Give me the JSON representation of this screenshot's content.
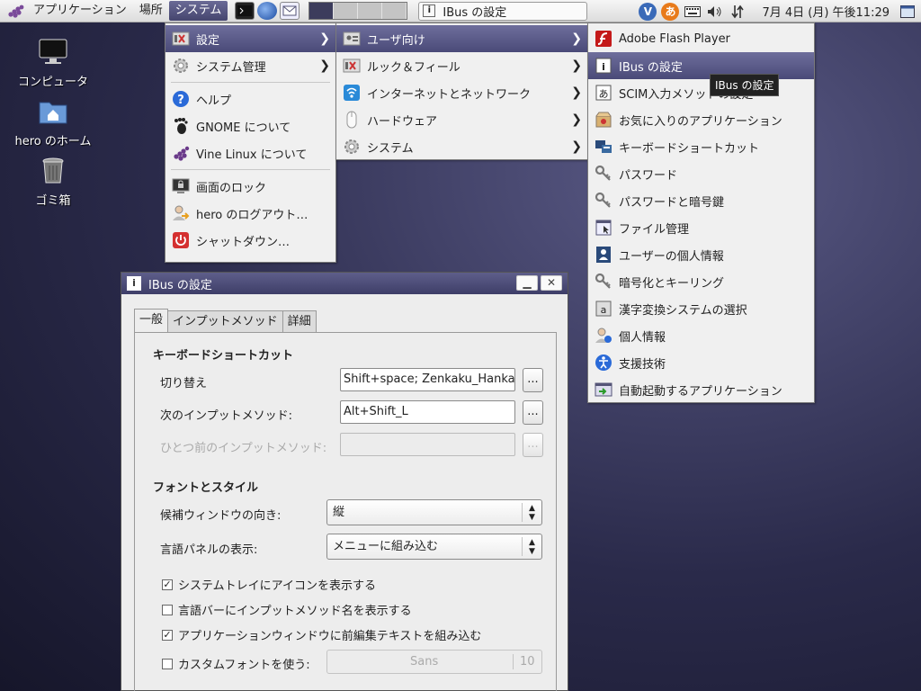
{
  "panel": {
    "menus": [
      "アプリケーション",
      "場所",
      "システム"
    ],
    "taskbar_title": "IBus の設定",
    "clock": "7月 4日 (月) 午後11:29",
    "ime_glyph": "あ",
    "vine_glyph": "V"
  },
  "desktop": [
    {
      "label": "コンピュータ",
      "icon": "computer-icon"
    },
    {
      "label": "hero のホーム",
      "icon": "home-folder-icon"
    },
    {
      "label": "ゴミ箱",
      "icon": "trash-icon"
    }
  ],
  "system_menu": {
    "items": [
      {
        "label": "設定",
        "icon": "settings-icon",
        "submenu": true,
        "highlight": true
      },
      {
        "label": "システム管理",
        "icon": "admin-gear-icon",
        "submenu": true
      },
      {
        "sep": true
      },
      {
        "label": "ヘルプ",
        "icon": "help-icon"
      },
      {
        "label": "GNOME について",
        "icon": "gnome-foot-icon"
      },
      {
        "label": "Vine Linux について",
        "icon": "vine-grape-icon"
      },
      {
        "sep": true
      },
      {
        "label": "画面のロック",
        "icon": "lock-screen-icon"
      },
      {
        "label": "hero のログアウト…",
        "icon": "logout-icon"
      },
      {
        "label": "シャットダウン…",
        "icon": "power-icon"
      }
    ]
  },
  "settings_menu": {
    "items": [
      {
        "label": "ユーザ向け",
        "icon": "user-prefs-icon",
        "submenu": true,
        "highlight": true
      },
      {
        "label": "ルック＆フィール",
        "icon": "appearance-icon",
        "submenu": true
      },
      {
        "label": "インターネットとネットワーク",
        "icon": "network-icon",
        "submenu": true
      },
      {
        "label": "ハードウェア",
        "icon": "mouse-icon",
        "submenu": true
      },
      {
        "label": "システム",
        "icon": "system-gear-icon",
        "submenu": true
      }
    ]
  },
  "user_menu": {
    "items": [
      {
        "label": "Adobe Flash Player",
        "icon": "flash-icon"
      },
      {
        "label": "IBus の設定",
        "icon": "ibus-icon",
        "highlight": true
      },
      {
        "label": "SCIM入力メソッドの設定",
        "icon": "scim-icon"
      },
      {
        "label": "お気に入りのアプリケーション",
        "icon": "favorite-apps-icon"
      },
      {
        "label": "キーボードショートカット",
        "icon": "keyboard-shortcut-icon"
      },
      {
        "label": "パスワード",
        "icon": "key-icon"
      },
      {
        "label": "パスワードと暗号鍵",
        "icon": "keys-icon"
      },
      {
        "label": "ファイル管理",
        "icon": "file-manager-icon"
      },
      {
        "label": "ユーザーの個人情報",
        "icon": "user-info-icon"
      },
      {
        "label": "暗号化とキーリング",
        "icon": "keyring-icon"
      },
      {
        "label": "漢字変換システムの選択",
        "icon": "kanji-icon"
      },
      {
        "label": "個人情報",
        "icon": "personal-icon"
      },
      {
        "label": "支援技術",
        "icon": "accessibility-icon"
      },
      {
        "label": "自動起動するアプリケーション",
        "icon": "autostart-icon"
      }
    ]
  },
  "tooltip": "IBus の設定",
  "dialog": {
    "title": "IBus の設定",
    "tabs": [
      "一般",
      "インプットメソッド",
      "詳細"
    ],
    "kbd_section": "キーボードショートカット",
    "switch_label": "切り替え",
    "switch_value": "Shift+space; Zenkaku_Hankaku",
    "next_label": "次のインプットメソッド:",
    "next_value": "Alt+Shift_L",
    "prev_label": "ひとつ前のインプットメソッド:",
    "prev_value": "",
    "dots": "...",
    "font_section": "フォントとスタイル",
    "orientation_label": "候補ウィンドウの向き:",
    "orientation_value": "縦",
    "panel_label": "言語パネルの表示:",
    "panel_value": "メニューに組み込む",
    "checks": [
      {
        "label": "システムトレイにアイコンを表示する",
        "checked": true
      },
      {
        "label": "言語バーにインプットメソッド名を表示する",
        "checked": false
      },
      {
        "label": "アプリケーションウィンドウに前編集テキストを組み込む",
        "checked": true
      },
      {
        "label": "カスタムフォントを使う:",
        "checked": false
      }
    ],
    "font_name": "Sans",
    "font_size": "10"
  }
}
